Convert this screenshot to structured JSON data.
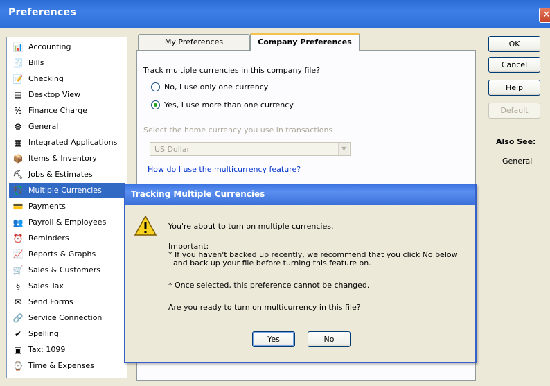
{
  "window": {
    "title": "Preferences",
    "close_glyph": "✕"
  },
  "sidebar": {
    "items": [
      {
        "label": "Accounting",
        "icon": "accounting-icon",
        "glyph": "📊"
      },
      {
        "label": "Bills",
        "icon": "bills-icon",
        "glyph": "🧾"
      },
      {
        "label": "Checking",
        "icon": "checking-icon",
        "glyph": "📝"
      },
      {
        "label": "Desktop View",
        "icon": "desktop-view-icon",
        "glyph": "▤"
      },
      {
        "label": "Finance Charge",
        "icon": "finance-charge-icon",
        "glyph": "%"
      },
      {
        "label": "General",
        "icon": "general-icon",
        "glyph": "⚙"
      },
      {
        "label": "Integrated Applications",
        "icon": "integrated-applications-icon",
        "glyph": "▦"
      },
      {
        "label": "Items & Inventory",
        "icon": "items-inventory-icon",
        "glyph": "📦"
      },
      {
        "label": "Jobs & Estimates",
        "icon": "jobs-estimates-icon",
        "glyph": "⛏"
      },
      {
        "label": "Multiple Currencies",
        "icon": "multiple-currencies-icon",
        "glyph": "💱"
      },
      {
        "label": "Payments",
        "icon": "payments-icon",
        "glyph": "💳"
      },
      {
        "label": "Payroll & Employees",
        "icon": "payroll-employees-icon",
        "glyph": "👥"
      },
      {
        "label": "Reminders",
        "icon": "reminders-icon",
        "glyph": "⏰"
      },
      {
        "label": "Reports & Graphs",
        "icon": "reports-graphs-icon",
        "glyph": "📈"
      },
      {
        "label": "Sales & Customers",
        "icon": "sales-customers-icon",
        "glyph": "🛒"
      },
      {
        "label": "Sales Tax",
        "icon": "sales-tax-icon",
        "glyph": "§"
      },
      {
        "label": "Send Forms",
        "icon": "send-forms-icon",
        "glyph": "✉"
      },
      {
        "label": "Service Connection",
        "icon": "service-connection-icon",
        "glyph": "🔗"
      },
      {
        "label": "Spelling",
        "icon": "spelling-icon",
        "glyph": "✔"
      },
      {
        "label": "Tax: 1099",
        "icon": "tax-1099-icon",
        "glyph": "▣"
      },
      {
        "label": "Time & Expenses",
        "icon": "time-expenses-icon",
        "glyph": "⌚"
      }
    ],
    "selected_index": 9
  },
  "tabs": {
    "my_preferences": "My Preferences",
    "company_preferences": "Company Preferences",
    "active": "company_preferences"
  },
  "panel": {
    "question": "Track multiple currencies in this company file?",
    "option_no": "No, I use only one currency",
    "option_yes": "Yes, I use more than one currency",
    "selected_option": "yes",
    "home_currency_label": "Select the home currency you use in transactions",
    "home_currency_value": "US Dollar",
    "help_link": "How do I use the multicurrency feature?"
  },
  "buttons": {
    "ok": "OK",
    "cancel": "Cancel",
    "help": "Help",
    "default": "Default"
  },
  "also_see": {
    "title": "Also See:",
    "items": [
      "General"
    ]
  },
  "modal": {
    "title": "Tracking Multiple Currencies",
    "icon": "warning-icon",
    "line1": "You're about to turn on multiple currencies.",
    "important_label": "Important:",
    "important_line1": "* If you haven't backed up recently, we recommend that you click No below",
    "important_line2": "  and back up your file before turning this feature on.",
    "once_selected": "* Once selected, this preference cannot be changed.",
    "question": "Are you ready to turn on multicurrency in this file?",
    "yes_label": "Yes",
    "no_label": "No"
  },
  "colors": {
    "titlebar": "#2b6cd4",
    "selection": "#316ac5",
    "tab_accent": "#f3c14c",
    "link": "#0033cc",
    "warning": "#f7d21e"
  }
}
